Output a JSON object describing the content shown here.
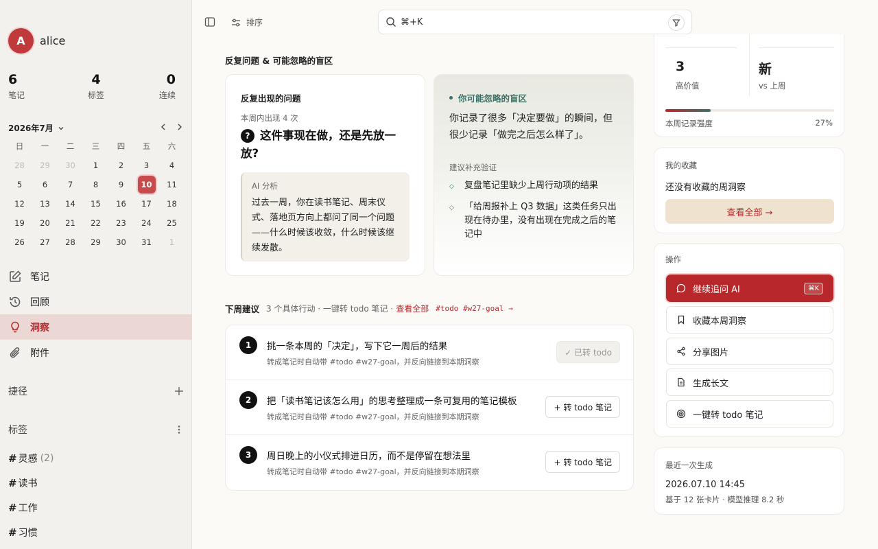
{
  "user": {
    "avatar_letter": "A",
    "name": "alice"
  },
  "stats": [
    {
      "num": "6",
      "label": "笔记"
    },
    {
      "num": "4",
      "label": "标签"
    },
    {
      "num": "0",
      "label": "连续"
    }
  ],
  "calendar": {
    "title": "2026年7月",
    "weekdays": [
      "日",
      "一",
      "二",
      "三",
      "四",
      "五",
      "六"
    ],
    "weeks": [
      [
        "28",
        "29",
        "30",
        "1",
        "2",
        "3",
        "4"
      ],
      [
        "5",
        "6",
        "7",
        "8",
        "9",
        "10",
        "11"
      ],
      [
        "12",
        "13",
        "14",
        "15",
        "16",
        "17",
        "18"
      ],
      [
        "19",
        "20",
        "21",
        "22",
        "23",
        "24",
        "25"
      ],
      [
        "26",
        "27",
        "28",
        "29",
        "30",
        "31",
        "1"
      ]
    ],
    "selected": "10"
  },
  "nav": [
    {
      "key": "notes",
      "label": "笔记",
      "icon": "edit-icon"
    },
    {
      "key": "review",
      "label": "回顾",
      "icon": "history-icon"
    },
    {
      "key": "insight",
      "label": "洞察",
      "icon": "lightbulb-icon",
      "active": true
    },
    {
      "key": "attach",
      "label": "附件",
      "icon": "paperclip-icon"
    }
  ],
  "shortcuts_label": "捷径",
  "tags_label": "标签",
  "tags": [
    {
      "name": "灵感",
      "count": "(2)"
    },
    {
      "name": "读书",
      "count": ""
    },
    {
      "name": "工作",
      "count": ""
    },
    {
      "name": "习惯",
      "count": ""
    }
  ],
  "topbar": {
    "sort_label": "排序",
    "search_text": "⌘+K"
  },
  "section1_title": "反复问题 & 可能忽略的盲区",
  "recurring": {
    "title": "反复出现的问题",
    "meta": "本周内出现 4 次",
    "question": "这件事现在做，还是先放一放?",
    "ai_label": "AI 分析",
    "ai_text": "过去一周，你在读书笔记、周末仪式、落地页方向上都问了同一个问题——什么时候该收敛，什么时候该继续发散。"
  },
  "blindspot": {
    "title": "你可能忽略的盲区",
    "body": "你记录了很多「决定要做」的瞬间，但很少记录「做完之后怎么样了」。",
    "suggest_label": "建议补充验证",
    "items": [
      "复盘笔记里缺少上周行动项的结果",
      "「给周报补上 Q3 数据」这类任务只出现在待办里，没有出现在完成之后的笔记中"
    ]
  },
  "next_week": {
    "title": "下周建议",
    "desc": "3 个具体行动 · 一键转 todo 笔记 ·",
    "link": "查看全部",
    "tags": "#todo #w27-goal →",
    "items": [
      {
        "num": "1",
        "title": "挑一条本周的「决定」，写下它一周后的结果",
        "sub": "转成笔记时自动带 #todo #w27-goal，并反向链接到本期洞察",
        "btn": "✓ 已转 todo",
        "done": true
      },
      {
        "num": "2",
        "title": "把「读书笔记该怎么用」的思考整理成一条可复用的笔记模板",
        "sub": "转成笔记时自动带 #todo #w27-goal，并反向链接到本期洞察",
        "btn": "+ 转 todo 笔记",
        "done": false
      },
      {
        "num": "3",
        "title": "周日晚上的小仪式排进日历，而不是停留在想法里",
        "sub": "转成笔记时自动带 #todo #w27-goal，并反向链接到本期洞察",
        "btn": "+ 转 todo 笔记",
        "done": false
      }
    ]
  },
  "metrics": {
    "left_num": "3",
    "left_label": "高价值",
    "right_num": "新",
    "right_label": "vs 上周",
    "bar_label": "本周记录强度",
    "bar_value": "27%",
    "bar_fraction": 0.27
  },
  "favorites": {
    "title": "我的收藏",
    "empty": "还没有收藏的周洞察",
    "view_all": "查看全部 →"
  },
  "actions": {
    "title": "操作",
    "items": [
      {
        "label": "继续追问 AI",
        "icon": "chat-icon",
        "kbd": "⌘K",
        "primary": true
      },
      {
        "label": "收藏本周洞察",
        "icon": "bookmark-icon"
      },
      {
        "label": "分享图片",
        "icon": "share-icon"
      },
      {
        "label": "生成长文",
        "icon": "document-icon"
      },
      {
        "label": "一键转 todo 笔记",
        "icon": "target-icon"
      }
    ]
  },
  "last_gen": {
    "title": "最近一次生成",
    "time": "2026.07.10 14:45",
    "meta": "基于 12 张卡片 · 模型推理 8.2 秒"
  },
  "colors": {
    "accent": "#b8282b",
    "sidebar_bg": "#f3f1ed",
    "teal": "#3b7066"
  }
}
